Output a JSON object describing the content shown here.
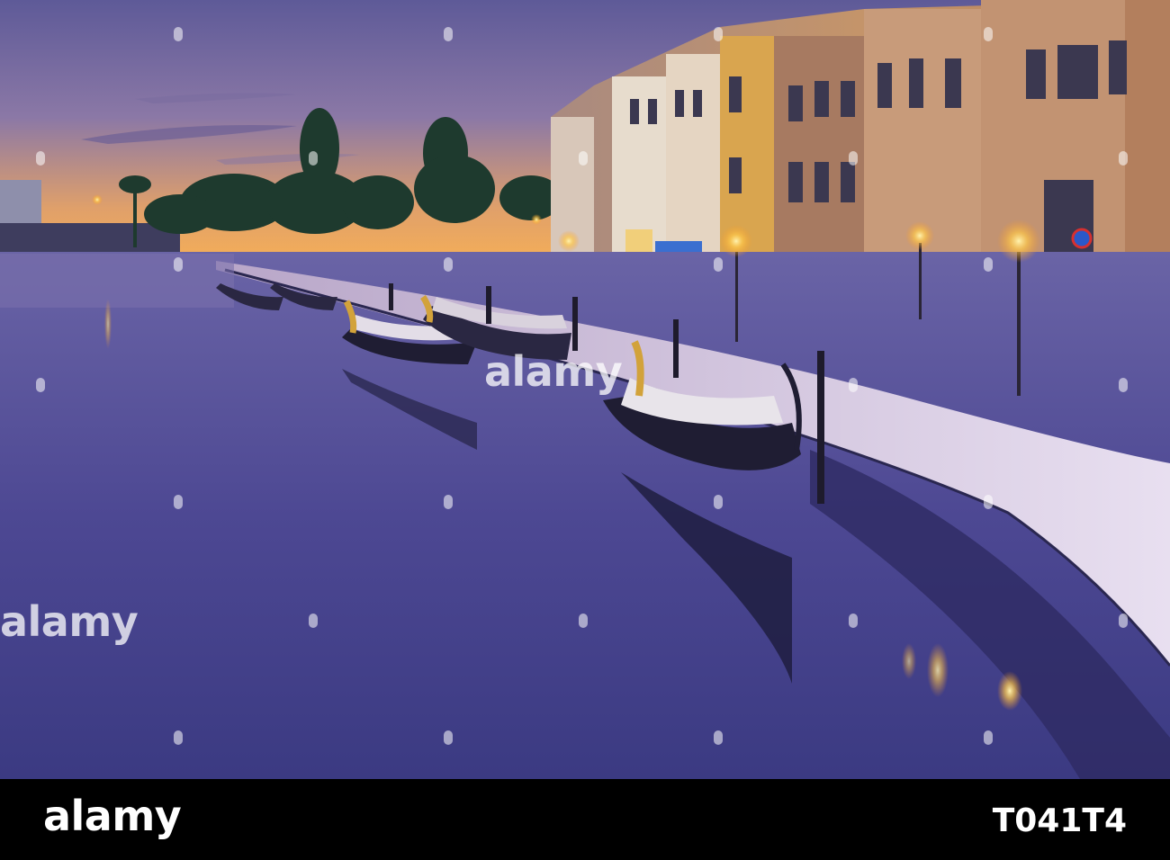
{
  "photo": {
    "subject": "canal-at-dusk",
    "colors": {
      "sky_top": "#6f5f9e",
      "sky_horizon": "#f0a45a",
      "water": "#4c4792",
      "building_warm": "#c7915c",
      "lamp_glow": "#ffd76a"
    }
  },
  "watermark": {
    "center_text": "alamy",
    "left_text": "alamy"
  },
  "footer": {
    "logo_text": "alamy",
    "image_id": "T041T4"
  }
}
